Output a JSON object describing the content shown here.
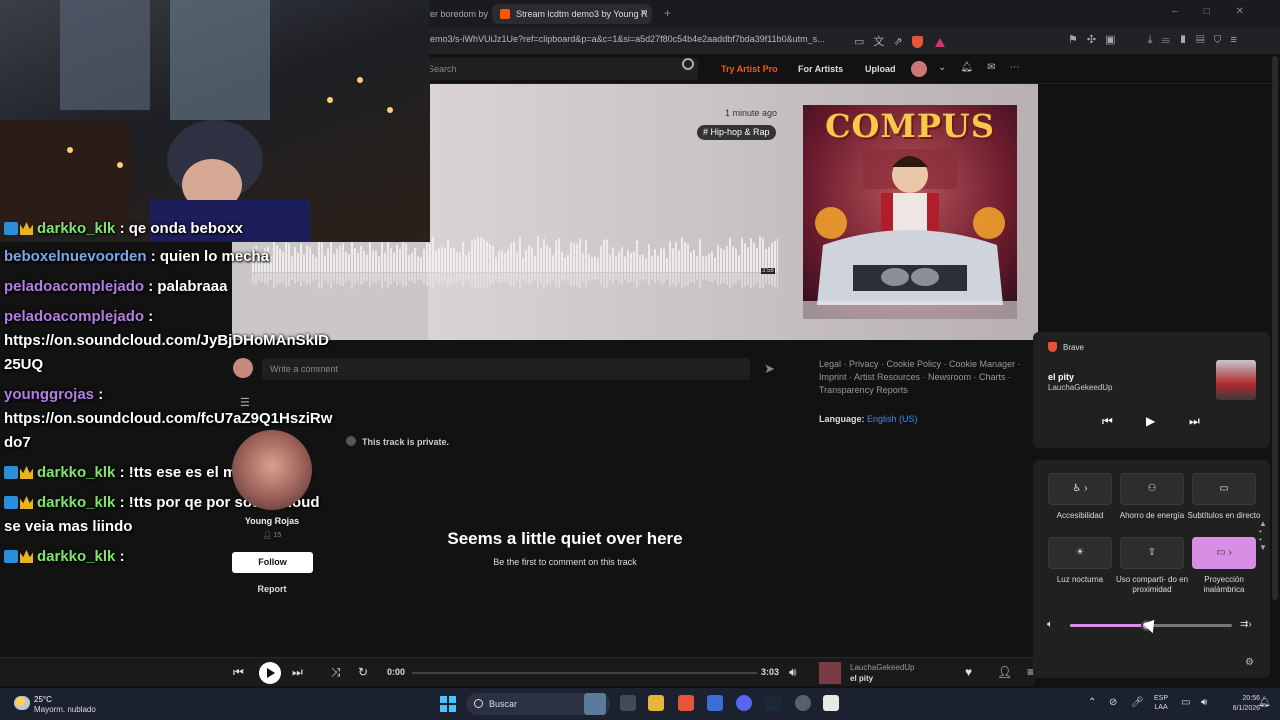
{
  "browser": {
    "inactive_tab": "er boredom by",
    "active_tab": "Stream lcdtm demo3 by Young R",
    "url": "emo3/s-iWhVUiJz1Ue?ref=clipboard&p=a&c=1&si=a5d27f80c54b4e2aaddbf7bda39f11b0&utm_s..."
  },
  "sc_header": {
    "search_placeholder": "Search",
    "try_pro": "Try Artist Pro",
    "for_artists": "For Artists",
    "upload": "Upload"
  },
  "track": {
    "time_ago": "1 minute ago",
    "genre": "# Hip-hop & Rap",
    "cover_title": "COMPUS",
    "duration_badge": "3:58",
    "private_notice": "This track is private."
  },
  "chat": [
    {
      "user": "darkko_klk",
      "text": ": qe onda beboxx",
      "color": "green",
      "badges": true
    },
    {
      "user": "beboxelnuevoorden",
      "text": ": quien lo mecha",
      "color": "blue",
      "badges": false
    },
    {
      "user": "peladoacomplejado",
      "text": ": palabraaa",
      "color": "purple",
      "badges": false
    },
    {
      "user": "peladoacomplejado",
      "text": ":",
      "color": "purple",
      "badges": false
    },
    {
      "text": "https://on.soundcloud.com/JyBjDHoMAnSkID"
    },
    {
      "text": "25UQ"
    },
    {
      "user": "younggrojas",
      "text": ":",
      "color": "purple",
      "badges": false
    },
    {
      "text": "https://on.soundcloud.com/fcU7aZ9Q1HsziRw"
    },
    {
      "text": "do7"
    },
    {
      "user": "darkko_klk",
      "text": ": !tts ese es el mismo tema",
      "color": "green",
      "badges": true
    },
    {
      "user": "darkko_klk",
      "text": ": !tts por qe por soundcloud",
      "color": "green",
      "badges": true
    },
    {
      "text": "se veia mas liindo"
    },
    {
      "user": "darkko_klk",
      "text": ":",
      "color": "green",
      "badges": true
    }
  ],
  "comment": {
    "placeholder": "Write a comment"
  },
  "artist": {
    "name": "Young Rojas",
    "followers": "15",
    "follow_label": "Follow",
    "report_label": "Report"
  },
  "empty_comments": {
    "title": "Seems a little quiet over here",
    "subtitle": "Be the first to comment on this track"
  },
  "footer": {
    "links": "Legal · Privacy · Cookie Policy · Cookie Manager · Imprint · Artist Resources · Newsroom · Charts · Transparency Reports",
    "language_label": "Language:",
    "language_value": "English (US)"
  },
  "player": {
    "current_time": "0:00",
    "total_time": "3:03",
    "artist": "LauchaGekeedUp",
    "title": "el pity",
    "progress": 0
  },
  "media_popup": {
    "app": "Brave",
    "title": "el pity",
    "artist": "LauchaGekeedUp"
  },
  "quick_settings": {
    "tiles": [
      {
        "label": "Accesibilidad",
        "active": false
      },
      {
        "label": "Ahorro de energía",
        "active": false
      },
      {
        "label": "Subtítulos en directo",
        "active": false
      },
      {
        "label": "Luz nocturna",
        "active": false
      },
      {
        "label": "Uso comparti- do en proximidad",
        "active": false
      },
      {
        "label": "Proyección inalámbrica",
        "active": true
      }
    ],
    "volume": 0.47,
    "accent": "#d78fe6"
  },
  "taskbar": {
    "temperature": "25°C",
    "condition": "Mayorm. nublado",
    "search": "Buscar",
    "lang_top": "ESP",
    "lang_bottom": "LAA",
    "time": "20:56",
    "date": "6/1/2026"
  }
}
